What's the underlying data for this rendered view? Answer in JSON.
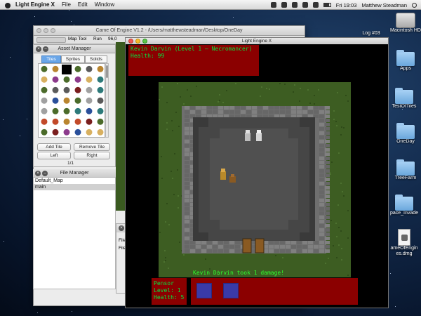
{
  "menubar": {
    "app_name": "Light Engine X",
    "items": [
      "File",
      "Edit",
      "Window"
    ],
    "clock": "Fri 19:03",
    "user": "Matthew Steadman"
  },
  "desktop": {
    "icons": [
      {
        "label": "Macintosh HD",
        "kind": "hdd-icon"
      },
      {
        "label": "Log #03",
        "kind": "folder-icon"
      },
      {
        "label": "Apps",
        "kind": "folder-icon"
      },
      {
        "label": "TestOfTiles",
        "kind": "folder-icon"
      },
      {
        "label": "OneDay",
        "kind": "folder-icon"
      },
      {
        "label": "TreeFarm",
        "kind": "folder-icon"
      },
      {
        "label": "pace_Invade",
        "kind": "folder-icon"
      },
      {
        "label": "ameOfEngin es.dmg",
        "kind": "dmg-icon"
      }
    ]
  },
  "editor": {
    "title": "Came Of Engine V1.2 - /Users/matthewsteadman/Desktop/OneDay",
    "toolbar": {
      "map_tool": "Map Tool",
      "run": "Run",
      "coord": "96,0"
    },
    "asset_manager": {
      "title": "Asset Manager",
      "tabs": [
        "Tiles",
        "Sprites",
        "Solids"
      ],
      "active_tab": "Tiles",
      "add_tile": "Add Tile",
      "remove_tile": "Remove Tile",
      "left": "Left",
      "right": "Right",
      "page": "1/1"
    },
    "file_manager": {
      "title": "File Manager",
      "items": [
        "Default_Map",
        "main"
      ],
      "selected": "main"
    },
    "side_panel": {
      "labels": [
        "File",
        "File T"
      ]
    }
  },
  "game": {
    "title": "Light Engine X",
    "player": {
      "name_line": "Kevin Darvin (Level 1 – Necromancer)",
      "health_line": "Health: 99"
    },
    "message": "Kevin Darvin took 1 damage!",
    "enemy": {
      "name": "Pensor",
      "level": "Level: 1",
      "health": "Health: 5"
    },
    "colors": {
      "hud_bg": "#8b0000",
      "hud_text": "#00e640",
      "grass": "#3d5d22",
      "wall": "#6f6f6f",
      "floor": "#4a4a4a"
    }
  }
}
